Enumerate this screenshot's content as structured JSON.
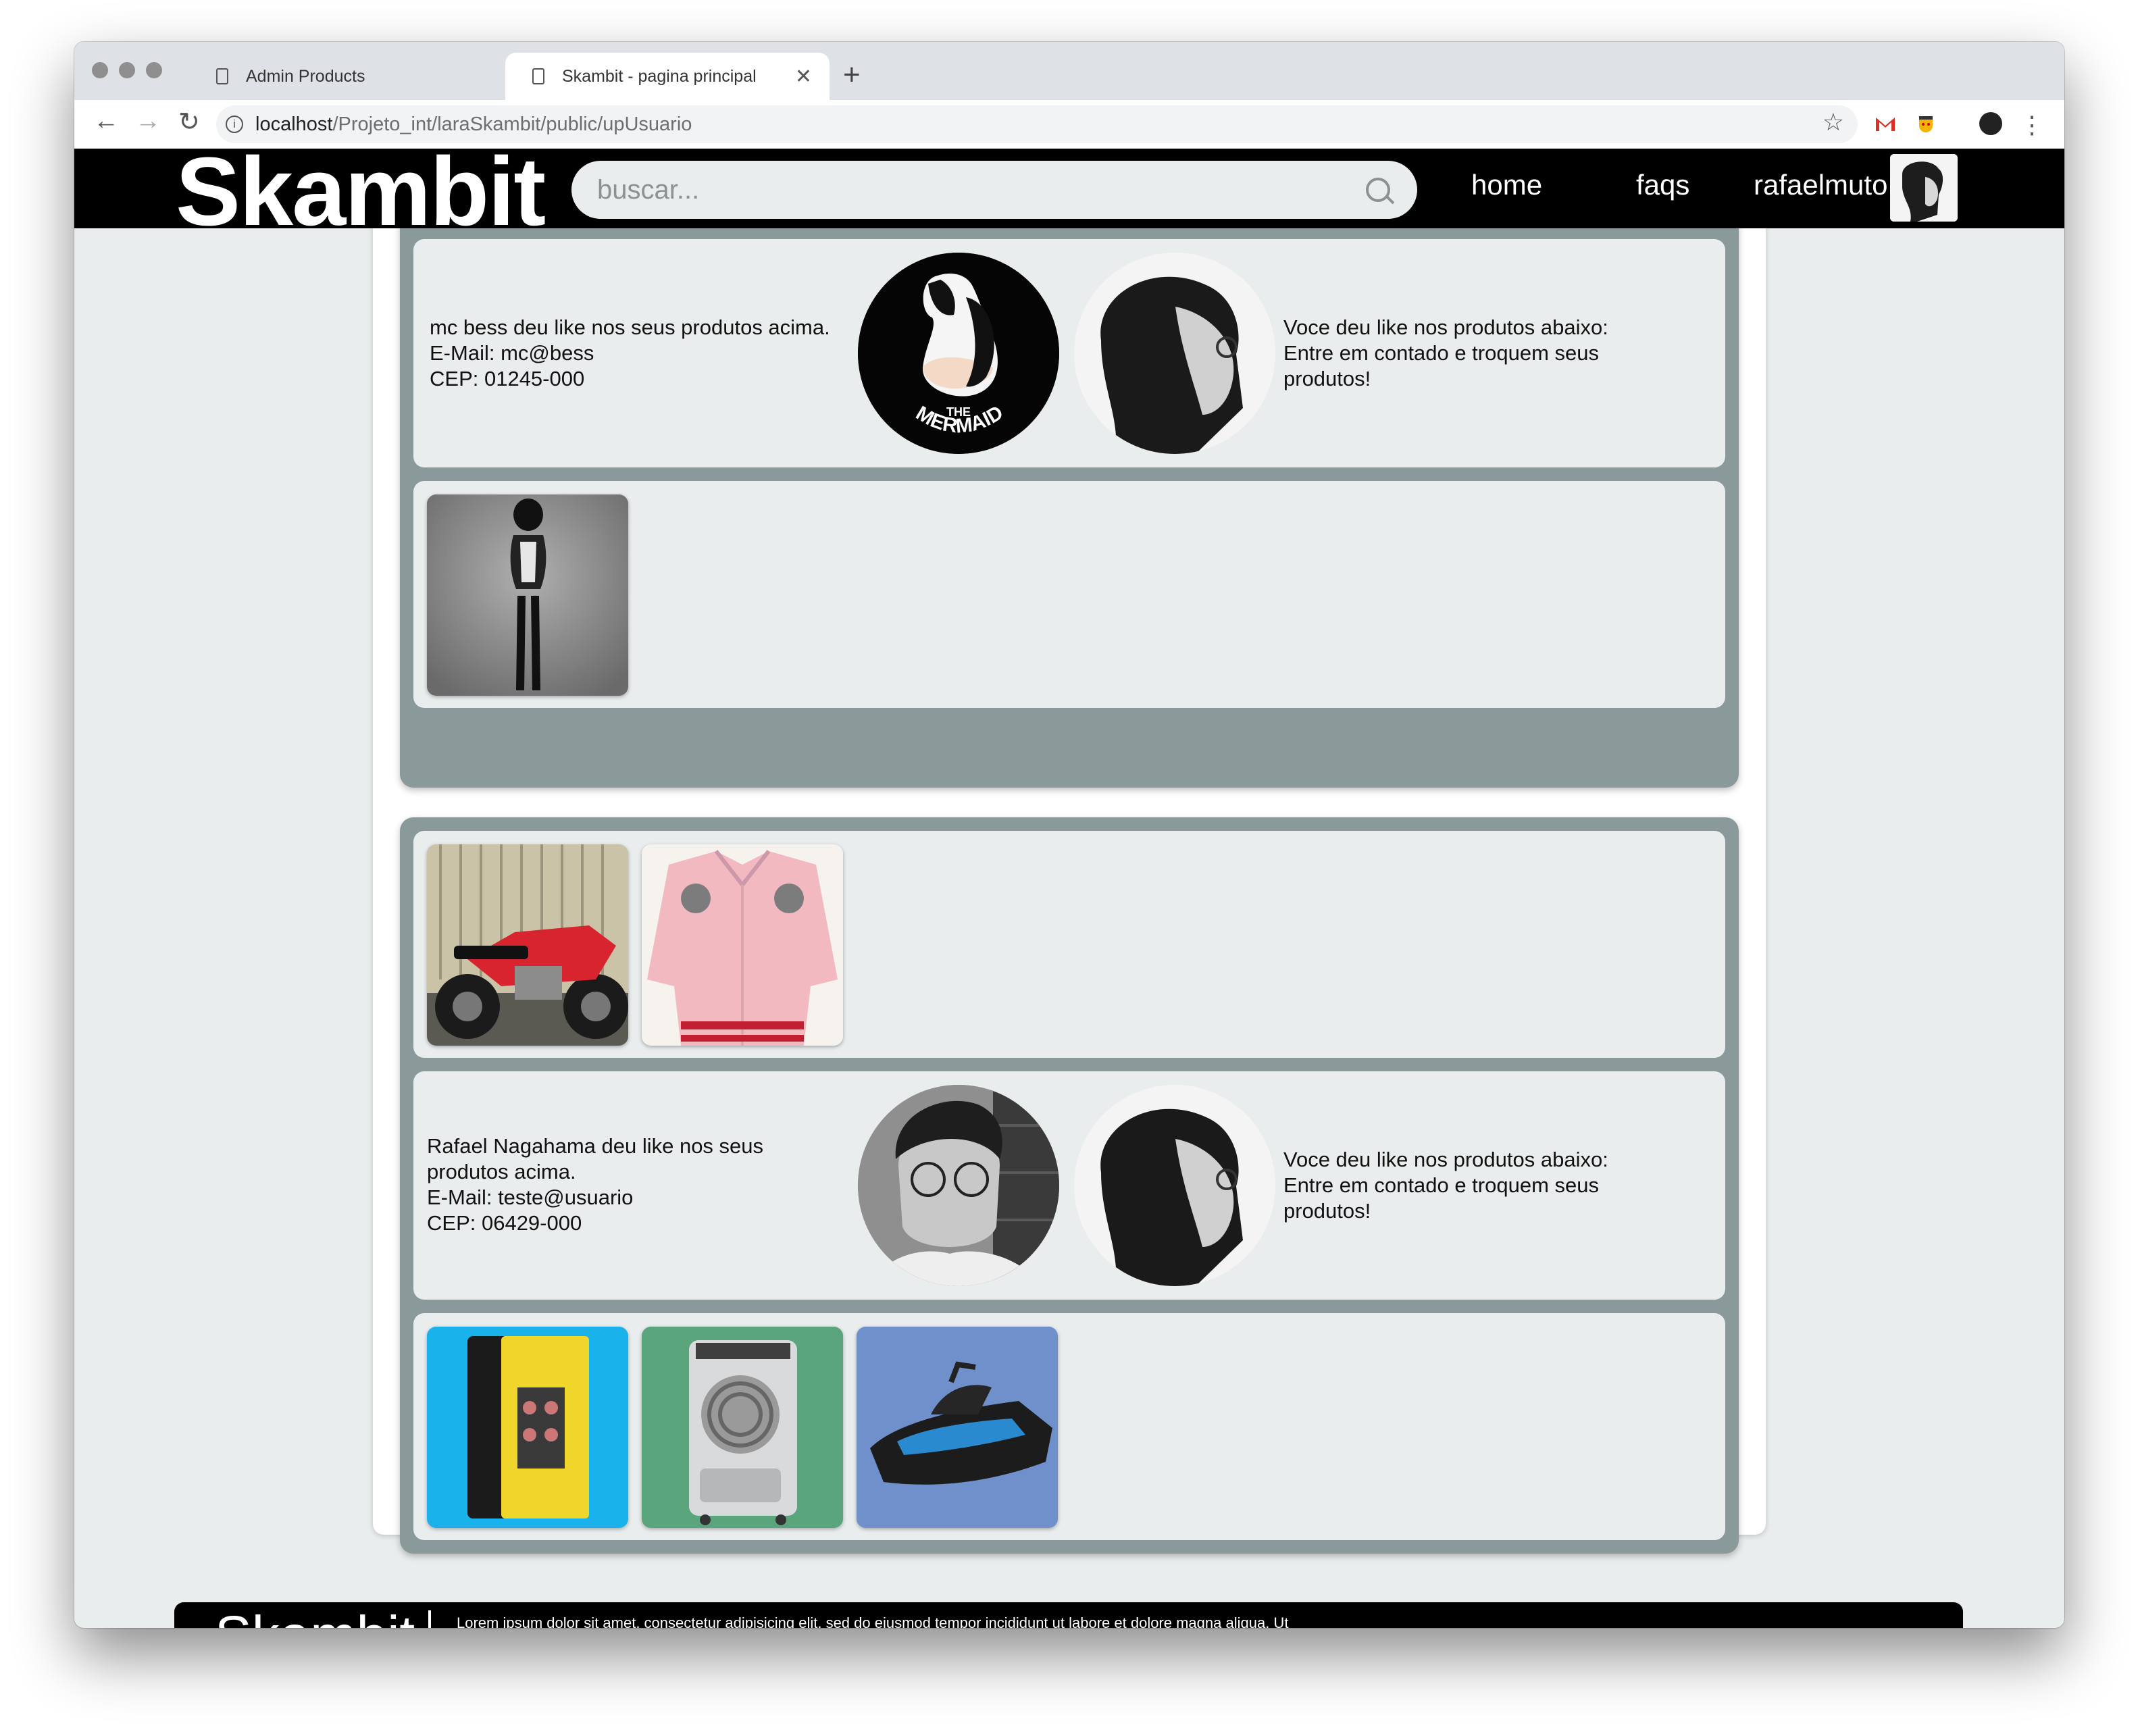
{
  "browser": {
    "tabs": [
      {
        "title": "Admin Products",
        "active": false
      },
      {
        "title": "Skambit - pagina principal",
        "active": true
      }
    ],
    "new_tab_label": "+",
    "url_host": "localhost",
    "url_path": "/Projeto_int/laraSkambit/public/upUsuario"
  },
  "header": {
    "brand": "Skambit",
    "search_placeholder": "buscar...",
    "nav": {
      "home": "home",
      "faqs": "faqs",
      "user": "rafaelmuto"
    }
  },
  "matches": [
    {
      "my_products": [],
      "info_lines": [
        "mc bess deu like nos seus produtos acima.",
        "E-Mail: mc@bess",
        "CEP: 01245-000"
      ],
      "other_avatar": "mermaid-logo-avatar",
      "self_avatar": "profile-photo-avatar",
      "right_lines": [
        "Voce deu like nos produtos abaixo:",
        "Entre em contado e troquem seus",
        "produtos!"
      ],
      "their_products": [
        "figure-photo"
      ]
    },
    {
      "my_products": [
        "red-motorcycle-photo",
        "pink-jacket-photo"
      ],
      "info_lines": [
        "Rafael Nagahama deu like nos seus",
        "produtos acima.",
        "E-Mail: teste@usuario",
        "CEP: 06429-000"
      ],
      "other_avatar": "man-glasses-avatar",
      "self_avatar": "profile-photo-avatar",
      "right_lines": [
        "Voce deu like nos produtos abaixo:",
        "Entre em contado e troquem seus",
        "produtos!"
      ],
      "their_products": [
        "mini-fridge-photo",
        "air-cooler-photo",
        "jet-ski-photo"
      ]
    }
  ],
  "footer": {
    "brand": "Skambit",
    "text": "Lorem ipsum dolor sit amet, consectetur adipisicing elit, sed do eiusmod tempor incididunt ut labore et dolore magna aliqua. Ut enim ad minim veniam, quis nostrud exercitation ullamco laboris nisi ut aliquip ex ea commodo consequat."
  },
  "colors": {
    "header_bg": "#000000",
    "page_bg": "#e9eded",
    "group_bg": "#8a9999",
    "card_bg": "#e9eded"
  }
}
